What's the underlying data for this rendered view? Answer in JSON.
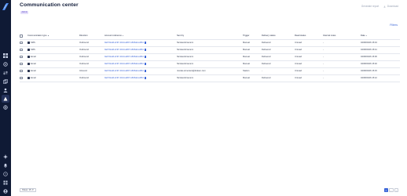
{
  "page": {
    "title": "Communication center",
    "badge": "Admin"
  },
  "header_actions": {
    "generate_report": "Generate report",
    "download": "Download"
  },
  "filters_label": "Filters",
  "table": {
    "columns": [
      "Communication type",
      "Direction",
      "Account reference",
      "Sent by",
      "Trigger",
      "Delivery status",
      "Read status",
      "Internal notes",
      "Date"
    ],
    "rows": [
      {
        "type": "SMS",
        "direction": "Outbound",
        "account": "9ab73edd-2c97-40cd-a997-1826abce9fbc",
        "sent_by": "Nicolas Elmerami",
        "trigger": "Manual",
        "delivery": "Delivered",
        "read": "Unread",
        "notes": "-",
        "date": "04/08/2026 15:43"
      },
      {
        "type": "SMS",
        "direction": "Outbound",
        "account": "9ab73edd-2c97-40cd-a997-1826abce9fbc",
        "sent_by": "Nicolas Elmerami",
        "trigger": "Manual",
        "delivery": "Delivered",
        "read": "Unread",
        "notes": "-",
        "date": "04/08/2026 15:41"
      },
      {
        "type": "Email",
        "direction": "Outbound",
        "account": "9ab73edd-2c97-40cd-a997-1826abce9fbc",
        "sent_by": "Nicolas Elmerami",
        "trigger": "Manual",
        "delivery": "Delivered",
        "read": "Unread",
        "notes": "-",
        "date": "04/08/2026 15:36"
      },
      {
        "type": "Email",
        "direction": "Outbound",
        "account": "9ab73edd-2c97-40cd-a997-1826abce9fbc",
        "sent_by": "Nicolas Elmerami",
        "trigger": "Manual",
        "delivery": "Delivered",
        "read": "Unread",
        "notes": "-",
        "date": "04/08/2026 15:32"
      },
      {
        "type": "Email",
        "direction": "Inbound",
        "account": "9ab73edd-2c97-40cd-a997-1826abce9fbc",
        "sent_by": "nicolas.elmerami@kraken.com",
        "trigger": "Station",
        "delivery": "-",
        "read": "Unread",
        "notes": "-",
        "date": "04/08/2026 15:15"
      },
      {
        "type": "Email",
        "direction": "Outbound",
        "account": "9ab73edd-2c97-40cd-a997-1826abce9fbc",
        "sent_by": "Nicolas Elmerami",
        "trigger": "Manual",
        "delivery": "Delivered",
        "read": "Unread",
        "notes": "-",
        "date": "04/08/2026 15:12"
      }
    ]
  },
  "footer": {
    "show_label": "Show: 15",
    "pages": [
      "1",
      "‹",
      "›"
    ]
  },
  "sidebar_icons": [
    "grid-icon",
    "settings-icon",
    "arrows-icon",
    "copy-icon",
    "user-icon",
    "communication-icon",
    "globe-icon",
    "sparkle-icon",
    "bell-icon",
    "help-icon",
    "apps-icon",
    "profile-icon"
  ],
  "colors": {
    "sidebar": "#0f1a35",
    "accent": "#3d67d8",
    "badge_bg": "#e4defa",
    "badge_text": "#5b48c8"
  }
}
